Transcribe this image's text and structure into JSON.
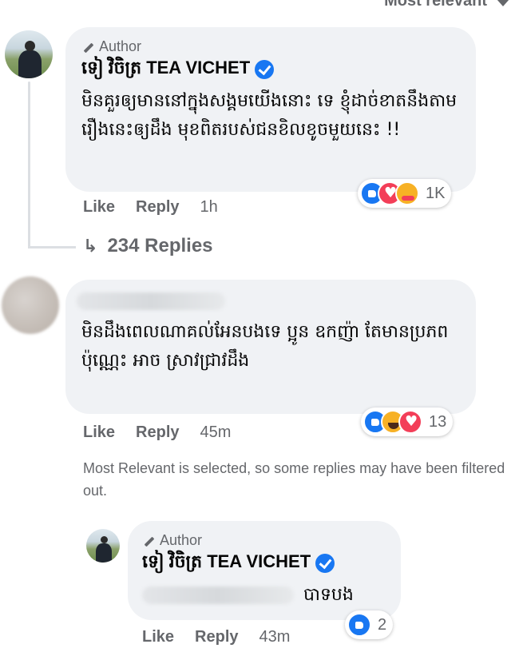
{
  "sort": {
    "label": "Most relevant"
  },
  "comment1": {
    "author_tag": "Author",
    "name": "ទៀ វិចិត្រ TEA VICHET",
    "text": "មិនគួរឲ្យមាននៅក្នុងសង្គមយើងនោះ ទេ ខ្ញុំដាច់ខាតនឹងតាមរឿងនេះឲ្យដឹង មុខពិតរបស់ជនខិលខូចមួយនេះ !!",
    "reactions": [
      "like",
      "love",
      "care"
    ],
    "reaction_count": "1K",
    "like": "Like",
    "reply": "Reply",
    "time": "1h"
  },
  "replies_link": {
    "label": "234 Replies"
  },
  "comment2": {
    "text": "មិនដឹងពេលណាគល់អែនបងទេ ប្អូន ឧកញ៉ា តែមានប្រភពប៉ុណ្ណេះ អាច ស្រាវជ្រាវដឹង",
    "reactions": [
      "like",
      "haha",
      "love"
    ],
    "reaction_count": "13",
    "like": "Like",
    "reply": "Reply",
    "time": "45m"
  },
  "filter_note": {
    "text": "Most Relevant is selected, so some replies may have been filtered out."
  },
  "reply1": {
    "author_tag": "Author",
    "name": "ទៀ វិចិត្រ TEA VICHET",
    "text": "បាទបង",
    "reactions": [
      "like"
    ],
    "reaction_count": "2",
    "like": "Like",
    "reply": "Reply",
    "time": "43m"
  },
  "colors": {
    "bubble": "#f0f2f5",
    "secondary_text": "#65676b",
    "verified": "#1877f2"
  }
}
